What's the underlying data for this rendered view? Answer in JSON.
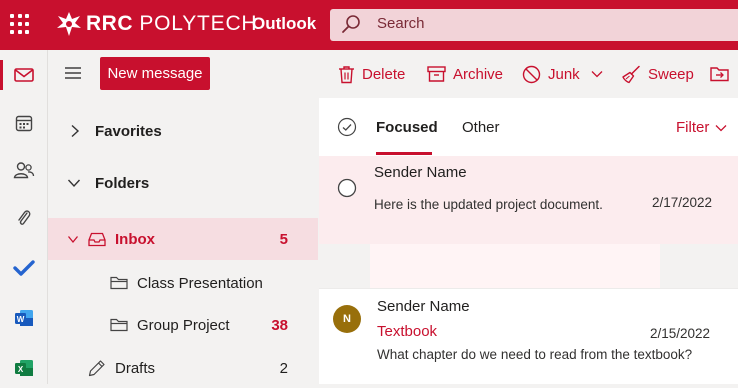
{
  "header": {
    "brand_name": "RRC",
    "brand_suffix": "POLYTECH",
    "app_title": "Outlook",
    "search_placeholder": "Search",
    "brand_color": "#c8102e"
  },
  "rail": {
    "apps": [
      "mail-icon",
      "calendar-icon",
      "people-icon",
      "attachment-icon",
      "todo-icon",
      "word-icon",
      "excel-icon"
    ]
  },
  "toolbar": {
    "new_message": "New message",
    "delete": "Delete",
    "archive": "Archive",
    "junk": "Junk",
    "sweep": "Sweep"
  },
  "folders": {
    "favorites": "Favorites",
    "folders": "Folders",
    "inbox": {
      "label": "Inbox",
      "count": "5"
    },
    "class_presentation": {
      "label": "Class Presentation"
    },
    "group_project": {
      "label": "Group Project",
      "count": "38"
    },
    "drafts": {
      "label": "Drafts",
      "count": "2"
    }
  },
  "pivot": {
    "focused": "Focused",
    "other": "Other",
    "filter": "Filter"
  },
  "messages": [
    {
      "sender": "Sender Name",
      "preview": "Here is the updated project document.",
      "date": "2/17/2022"
    },
    {
      "avatar": "N",
      "sender": "Sender Name",
      "subject": "Textbook",
      "preview": "What chapter do we need to read from the textbook?",
      "date": "2/15/2022"
    }
  ]
}
